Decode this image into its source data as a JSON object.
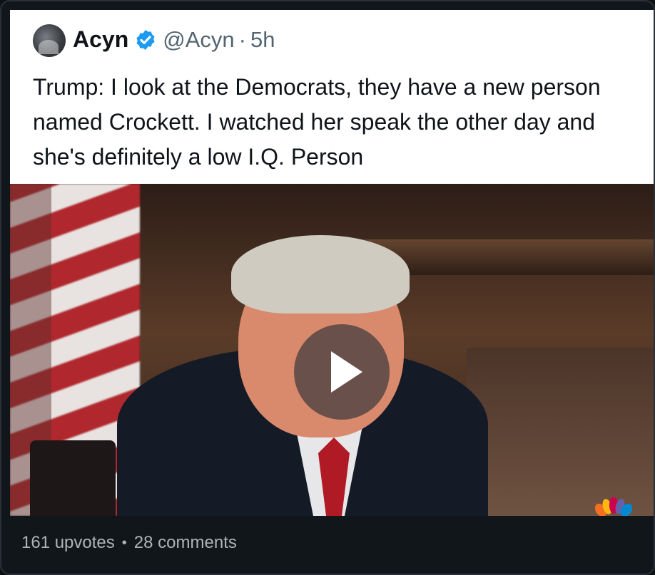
{
  "tweet": {
    "name": "Acyn",
    "handle": "@Acyn",
    "separator": "·",
    "time": "5h",
    "text": "Trump: I look at the Democrats, they have a new person named Crockett. I watched her speak the other day and she's definitely a low I.Q. Person"
  },
  "icons": {
    "verified": "verified-badge-icon",
    "play": "play-icon",
    "network_logo": "peacock-logo-icon"
  },
  "colors": {
    "verified": "#1d9bf0",
    "background": "#0e1113",
    "meta_text": "#aeb4b8"
  },
  "post": {
    "upvotes": "161 upvotes",
    "separator": "•",
    "comments": "28 comments"
  }
}
